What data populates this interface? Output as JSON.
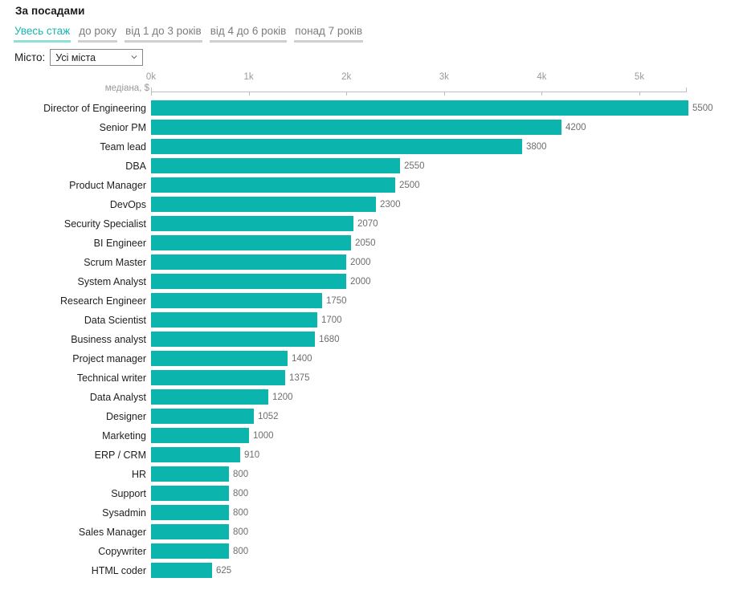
{
  "header": {
    "title": "За посадами"
  },
  "tabs": [
    {
      "label": "Увесь стаж",
      "active": true
    },
    {
      "label": "до року",
      "active": false
    },
    {
      "label": "від 1 до 3 років",
      "active": false
    },
    {
      "label": "від 4 до 6 років",
      "active": false
    },
    {
      "label": "понад 7 років",
      "active": false
    }
  ],
  "filter": {
    "label": "Місто:",
    "selected": "Усі міста",
    "options": [
      "Усі міста"
    ],
    "icon": "chevron-down-icon"
  },
  "colors": {
    "bar": "#0bb5ae",
    "accent": "#19b5b0",
    "accent_underline": "#8fdedc",
    "tab_inactive": "#7d7d7d",
    "tab_underline": "#cfcfcf",
    "axis": "#bdbdbd",
    "value_label": "#6e6e6e",
    "tick_label": "#9a9a9a"
  },
  "chart_data": {
    "type": "bar",
    "orientation": "horizontal",
    "title": "За посадами",
    "xlabel": "медіана, $",
    "ylabel": "",
    "xlim": [
      0,
      5480
    ],
    "grid": false,
    "legend": null,
    "tick_labels": [
      "0k",
      "1k",
      "2k",
      "3k",
      "4k",
      "5k"
    ],
    "tick_values": [
      0,
      1000,
      2000,
      3000,
      4000,
      5000
    ],
    "categories": [
      "Director of Engineering",
      "Senior PM",
      "Team lead",
      "DBA",
      "Product Manager",
      "DevOps",
      "Security Specialist",
      "BI Engineer",
      "Scrum Master",
      "System Analyst",
      "Research Engineer",
      "Data Scientist",
      "Business analyst",
      "Project manager",
      "Technical writer",
      "Data Analyst",
      "Designer",
      "Marketing",
      "ERP / CRM",
      "HR",
      "Support",
      "Sysadmin",
      "Sales Manager",
      "Copywriter",
      "HTML coder"
    ],
    "values": [
      5500,
      4200,
      3800,
      2550,
      2500,
      2300,
      2070,
      2050,
      2000,
      2000,
      1750,
      1700,
      1680,
      1400,
      1375,
      1200,
      1052,
      1000,
      910,
      800,
      800,
      800,
      800,
      800,
      625
    ],
    "value_labels": [
      "5500",
      "4200",
      "3800",
      "2550",
      "2500",
      "2300",
      "2070",
      "2050",
      "2000",
      "2000",
      "1750",
      "1700",
      "1680",
      "1400",
      "1375",
      "1200",
      "1052",
      "1000",
      "910",
      "800",
      "800",
      "800",
      "800",
      "800",
      "625"
    ]
  }
}
